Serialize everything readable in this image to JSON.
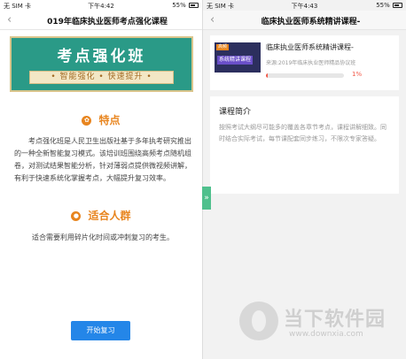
{
  "left_screen": {
    "status": {
      "carrier": "无 SIM 卡",
      "time": "下午4:42",
      "battery": "55%"
    },
    "nav": {
      "back_glyph": "‹",
      "title": "019年临床执业医师考点强化课程"
    },
    "banner": {
      "title": "考点强化班",
      "slogan": "• 智能强化 • 快速提升 •"
    },
    "feature": {
      "heading": "特点",
      "icon": "award-icon",
      "text": "考点强化班是人民卫生出版社基于多年执考研究推出的一种全新智能复习模式。该培训班围绕高频考点随机组卷，对测试结果智能分析，针对薄弱点提供微视频讲解，有利于快速系统化掌握考点，大幅提升复习效率。"
    },
    "audience": {
      "heading": "适合人群",
      "icon": "person-icon",
      "text": "适合需要利用碎片化时间或冲刺复习的考生。"
    },
    "start_button": "开始复习"
  },
  "side_toggle": "»",
  "right_screen": {
    "status": {
      "carrier": "无 SIM 卡",
      "time": "下午4:43",
      "battery": "55%"
    },
    "nav": {
      "back_glyph": "‹",
      "title": "临床执业医师系统精讲课程-"
    },
    "course": {
      "thumb_badge": "高频",
      "thumb_text": "系统精讲课程",
      "title": "临床执业医师系统精讲课程-",
      "source": "来源:2019年临床执业医师精品协议班",
      "progress_percent": 1,
      "progress_label": "1%"
    },
    "intro": {
      "title": "课程简介",
      "text": "按照考试大纲尽可能多的覆盖各章节考点，课程讲解细致。同时结合实际考试，每节课配套同步练习，不限次专家答疑。"
    },
    "watermark": {
      "name": "当下软件园",
      "url": "www.downxia.com"
    }
  },
  "colors": {
    "accent_orange": "#e8851f",
    "button_blue": "#2486e8",
    "banner_teal": "#2a9a87",
    "progress_red": "#f25a4a",
    "toggle_green": "#4fc08d"
  }
}
